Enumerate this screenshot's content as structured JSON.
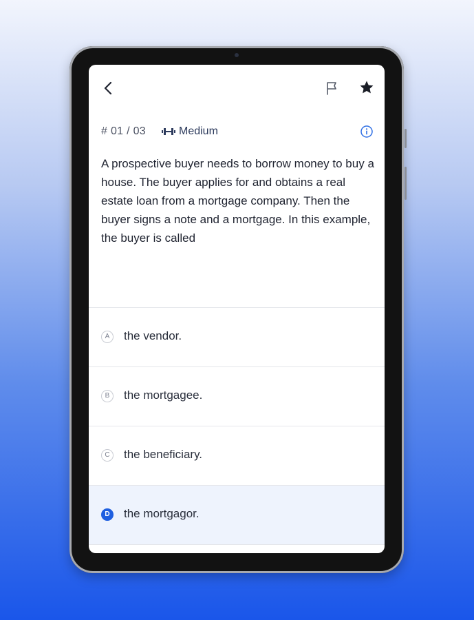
{
  "header": {
    "back_icon": "chevron-left-icon",
    "flag_icon": "flag-icon",
    "star_icon": "star-icon"
  },
  "meta": {
    "counter": "# 01 / 03",
    "difficulty_icon": "dumbbell-icon",
    "difficulty": "Medium",
    "info_icon": "info-icon"
  },
  "question": {
    "text": "A prospective buyer needs to borrow money to buy a house. The buyer applies for and obtains a real estate loan from a mortgage company. Then the buyer signs a note and a mortgage. In this example, the buyer is called"
  },
  "options": [
    {
      "letter": "A",
      "text": "the vendor.",
      "selected": false
    },
    {
      "letter": "B",
      "text": "the mortgagee.",
      "selected": false
    },
    {
      "letter": "C",
      "text": "the beneficiary.",
      "selected": false
    },
    {
      "letter": "D",
      "text": "the mortgagor.",
      "selected": true
    }
  ],
  "colors": {
    "accent": "#1f5fe0",
    "selected_bg": "#eef3fd",
    "background_top": "#f2f5fd",
    "background_bottom": "#1a56ea"
  }
}
